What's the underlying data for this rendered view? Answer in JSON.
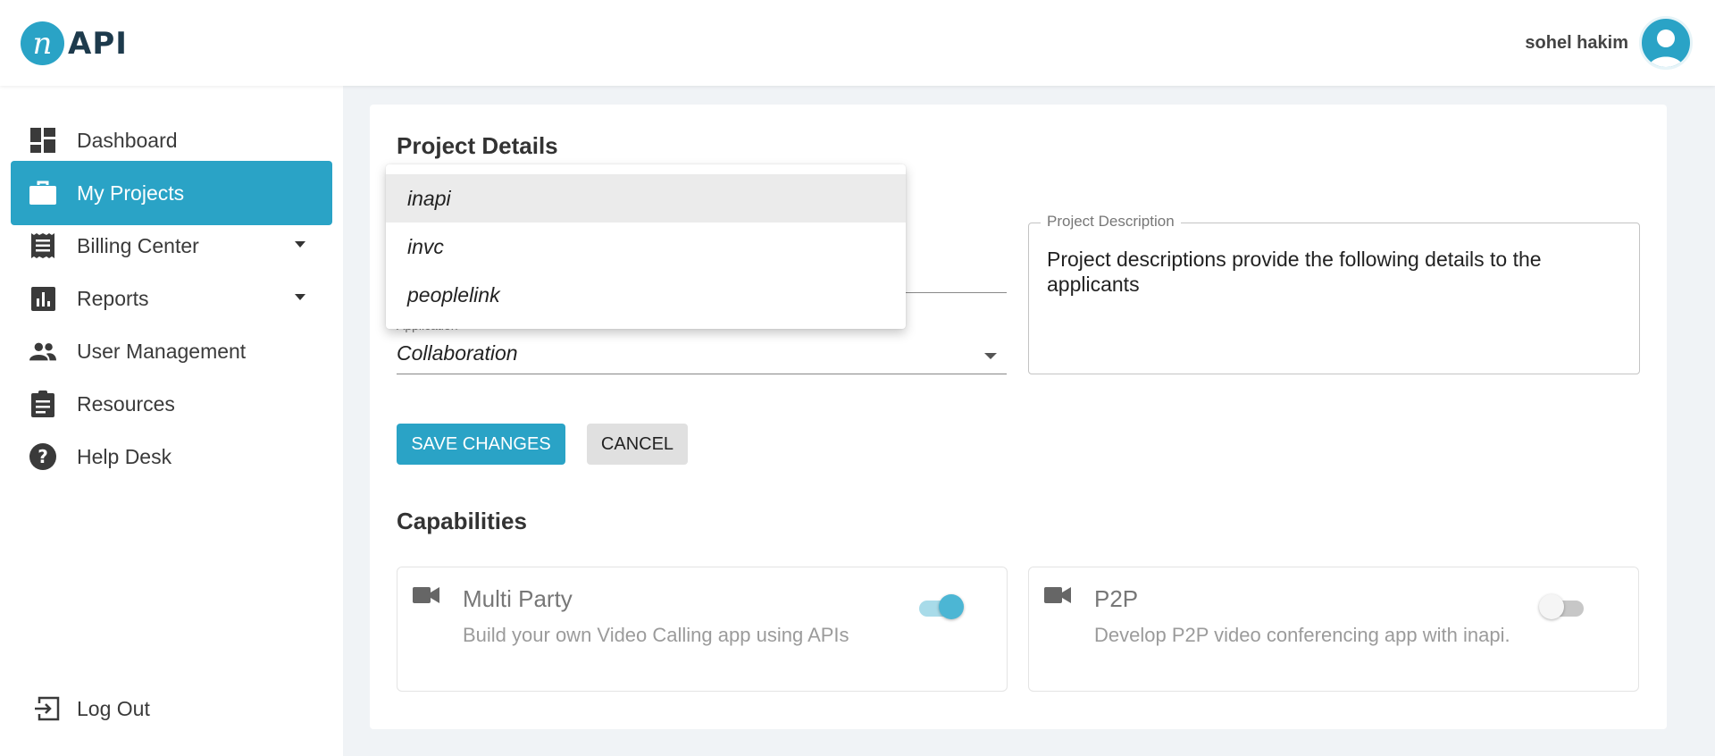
{
  "app": {
    "logo_letter": "n",
    "logo_text": "API",
    "brand_color": "#2aa3c6"
  },
  "header": {
    "user_name": "sohel hakim"
  },
  "sidebar": {
    "items": [
      {
        "label": "Dashboard",
        "icon": "dashboard-icon"
      },
      {
        "label": "My Projects",
        "icon": "briefcase-icon",
        "active": true
      },
      {
        "label": "Billing Center",
        "icon": "receipt-icon",
        "expandable": true
      },
      {
        "label": "Reports",
        "icon": "bar-chart-icon",
        "expandable": true
      },
      {
        "label": "User Management",
        "icon": "people-icon"
      },
      {
        "label": "Resources",
        "icon": "clipboard-icon"
      },
      {
        "label": "Help Desk",
        "icon": "help-icon"
      }
    ],
    "logout_label": "Log Out"
  },
  "project": {
    "title": "Project Details",
    "application": {
      "label": "Application",
      "value": "Collaboration"
    },
    "description": {
      "label": "Project Description",
      "value": "Project descriptions provide the following details to the applicants"
    },
    "save_label": "SAVE CHANGES",
    "cancel_label": "CANCEL"
  },
  "dropdown": {
    "options": [
      "inapi",
      "invc",
      "peoplelink"
    ],
    "highlighted": "inapi"
  },
  "capabilities": {
    "title": "Capabilities",
    "items": [
      {
        "title": "Multi Party",
        "description": "Build your own Video Calling app using APIs",
        "enabled": true,
        "icon": "video-camera-icon"
      },
      {
        "title": "P2P",
        "description": "Develop P2P video conferencing app with inapi.",
        "enabled": false,
        "icon": "video-camera-icon"
      }
    ]
  }
}
